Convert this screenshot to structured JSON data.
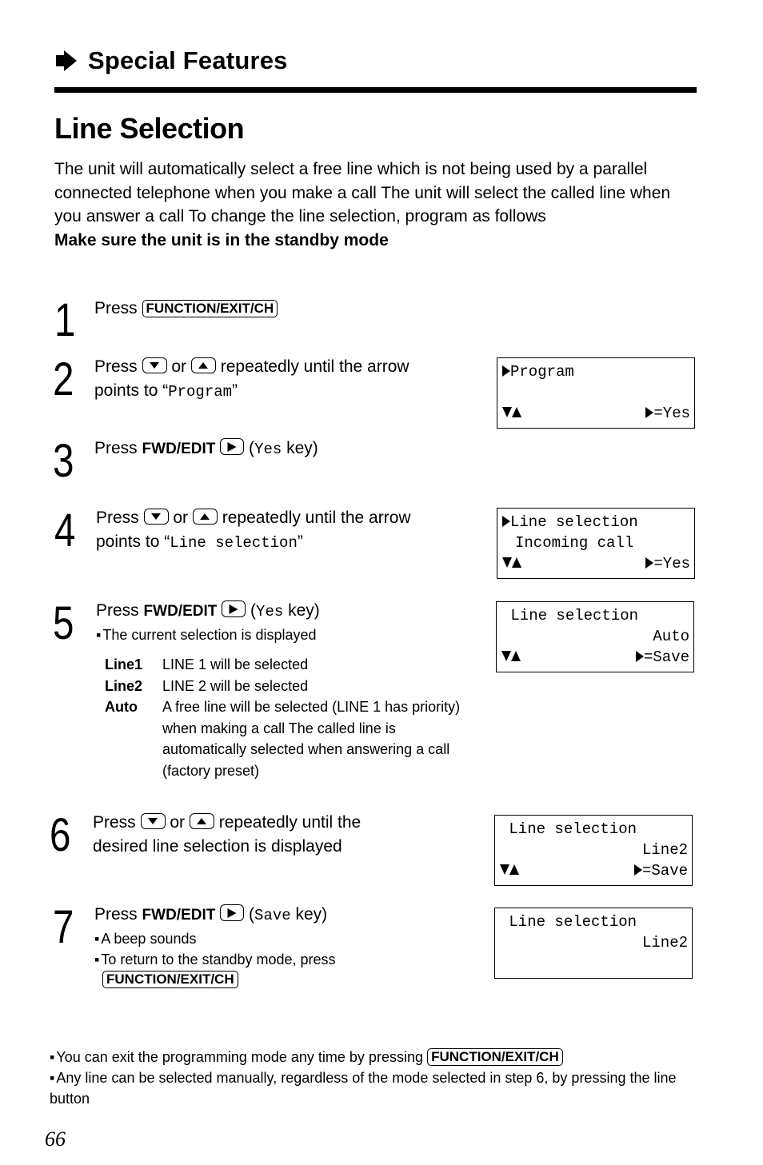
{
  "header": {
    "section_icon": "right-arrow-icon",
    "section_title": "Special Features"
  },
  "page_title": "Line Selection",
  "intro": {
    "paragraph": "The unit will automatically select a free line which is not being used by a parallel connected telephone when you make a call  The unit will select the called line when you answer a call  To change the line selection, program as follows",
    "bold_note": "Make sure the unit is in the standby mode"
  },
  "keys": {
    "function_exit_ch": "FUNCTION/EXIT/CH",
    "fwd_edit": "FWD/EDIT",
    "down_icon": "down-arrow-key-icon",
    "up_icon": "up-arrow-key-icon",
    "play_icon": "play-key-icon"
  },
  "steps": [
    {
      "number": "1",
      "press": "Press"
    },
    {
      "number": "2",
      "press": "Press",
      "or": "or",
      "rest": "repeatedly until the arrow",
      "line2_pre": "points to “",
      "mono": "Program",
      "line2_post": "”"
    },
    {
      "number": "3",
      "press": "Press",
      "paren_open": "(",
      "mono": "Yes",
      "paren_close": " key)"
    },
    {
      "number": "4",
      "press": "Press",
      "or": "or",
      "rest": "repeatedly until the arrow",
      "line2_pre": "points to “",
      "mono": "Line selection",
      "line2_post": "”"
    },
    {
      "number": "5",
      "press": "Press",
      "paren_open": "(",
      "mono": "Yes",
      "paren_close": " key)",
      "bullet": "The current selection is displayed",
      "options": [
        {
          "key": "Line1",
          "desc": "LINE 1 will be selected"
        },
        {
          "key": "Line2",
          "desc": "LINE 2 will be selected"
        },
        {
          "key": "Auto",
          "desc": "A free line will be selected (LINE 1 has priority) when making a call  The called line is automatically selected when answering a call (factory preset)"
        }
      ]
    },
    {
      "number": "6",
      "press": "Press",
      "or": "or",
      "rest": "repeatedly until the",
      "line2": "desired line selection is displayed"
    },
    {
      "number": "7",
      "press": "Press",
      "paren_open": "(",
      "mono": "Save",
      "paren_close": " key)",
      "bullets": [
        "A beep sounds",
        "To return to the standby mode, press"
      ]
    }
  ],
  "displays": [
    {
      "line1": "Program",
      "line1_arrow": true,
      "line2": "",
      "nav": true,
      "action": "=Yes"
    },
    {
      "line1": "Line selection",
      "line1_arrow": true,
      "line2": "Incoming call",
      "nav": true,
      "action": "=Yes"
    },
    {
      "line1": " Line selection",
      "line1_arrow": false,
      "line2": "Auto",
      "nav": true,
      "action": "=Save"
    },
    {
      "line1": " Line selection",
      "line1_arrow": false,
      "line2": "Line2",
      "nav": true,
      "action": "=Save"
    },
    {
      "line1": " Line selection",
      "line1_arrow": false,
      "line2": "Line2",
      "nav": false,
      "action": ""
    }
  ],
  "notes": [
    "You can exit the programming mode any time by pressing",
    "Any line can be selected manually, regardless of the mode selected in step 6, by pressing the line button"
  ],
  "page_number": "66"
}
